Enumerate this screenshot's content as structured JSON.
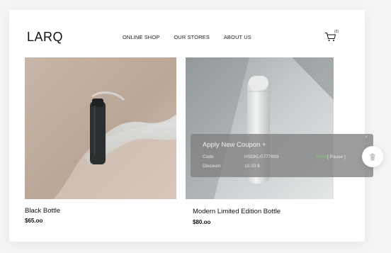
{
  "brand": {
    "logo": "LARQ"
  },
  "nav": {
    "items": [
      {
        "label": "ONLINE SHOP"
      },
      {
        "label": "OUR STORES"
      },
      {
        "label": "ABOUT US"
      }
    ]
  },
  "cart": {
    "count": "(0)",
    "icon": "cart-icon"
  },
  "products": [
    {
      "name": "Black Bottle",
      "price": "$65.oo"
    },
    {
      "name": "Modern Limited Edition Bottle",
      "price": "$80.oo"
    }
  ],
  "coupon": {
    "title": "Apply New Coupon +",
    "close": "×",
    "code_label": "Code",
    "code_value": "HSDKLG777893",
    "status_active": "Active",
    "status_pause": "[ Pause ]",
    "discount_label": "Discount",
    "discount_value": "10.00 $"
  },
  "delete": {
    "icon": "trash-icon"
  },
  "colors": {
    "accent_active": "#7ec96a",
    "overlay": "#808080"
  }
}
